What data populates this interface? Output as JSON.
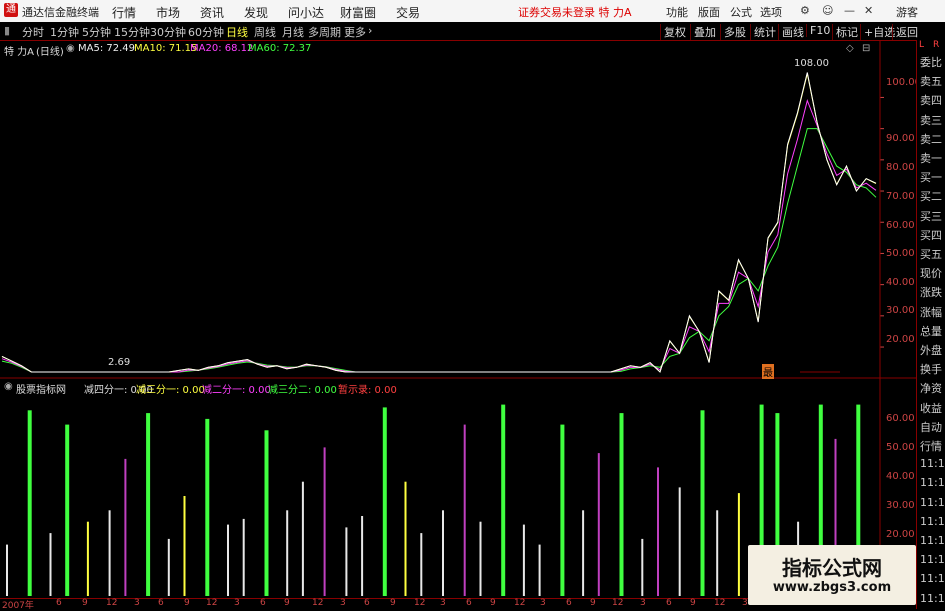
{
  "titlebar": {
    "logo": "通",
    "app_name": "通达信金融终端",
    "menus": [
      "行情",
      "市场",
      "资讯",
      "发现",
      "问小达",
      "财富圈",
      "交易"
    ],
    "notice": "证券交易未登录 特 力A",
    "right_menus": [
      "功能",
      "版面",
      "公式",
      "选项"
    ],
    "guest": "游客"
  },
  "toolbar": {
    "periods": [
      "分时",
      "1分钟",
      "5分钟",
      "15分钟",
      "30分钟",
      "60分钟",
      "日线",
      "周线",
      "月线",
      "多周期",
      "更多"
    ],
    "active": "日线",
    "right_buttons": [
      "复权",
      "叠加",
      "多股",
      "统计",
      "画线",
      "F10",
      "标记",
      "+自选",
      "返回"
    ]
  },
  "info": {
    "stock": "特 力A",
    "period": "(日线)",
    "ma5": "MA5: 72.49",
    "ma10": "MA10: 71.15",
    "ma20": "MA20: 68.12",
    "ma60": "MA60: 72.37"
  },
  "right_panel": {
    "corner_l": "L",
    "corner_r": "R",
    "items": [
      "委比",
      "卖五",
      "卖四",
      "卖三",
      "卖二",
      "卖一",
      "买一",
      "买二",
      "买三",
      "买四",
      "买五",
      "现价",
      "涨跌",
      "涨幅",
      "总量",
      "外盘",
      "换手",
      "净资",
      "收益",
      "自动",
      "行情",
      "11:1",
      "11:1",
      "11:1",
      "11:1",
      "11:1",
      "11:1",
      "11:1",
      "11:1"
    ]
  },
  "price_axis": [
    "100.00",
    "90.00",
    "80.00",
    "70.00",
    "60.00",
    "50.00",
    "40.00",
    "30.00",
    "20.00"
  ],
  "chart_annotations": {
    "high": "108.00",
    "low": "2.69",
    "marker": "最"
  },
  "indicator": {
    "name": "股票指标网",
    "f1": "减四分一: 0.00",
    "f2": "减三分一: 0.00",
    "f3": "减二分一: 0.00",
    "f4": "减三分二: 0.00",
    "f5": "暂示录: 0.00",
    "axis": [
      "60.00",
      "50.00",
      "40.00",
      "30.00",
      "20.00"
    ]
  },
  "date_axis": [
    "2007年",
    "6",
    "9",
    "12",
    "3",
    "6",
    "9",
    "12",
    "3",
    "6",
    "9",
    "12",
    "3",
    "6",
    "9",
    "12",
    "3",
    "6",
    "9",
    "12",
    "3",
    "6",
    "9",
    "12",
    "3",
    "6",
    "9",
    "12",
    "3",
    "6",
    "9",
    "12",
    "3",
    "6",
    "9",
    "12",
    "3",
    "6",
    "9",
    "12"
  ],
  "watermark": {
    "line1": "指标公式网",
    "line2": "www.zbgs3.com"
  },
  "chart_data": {
    "type": "line",
    "price_ylim": [
      12,
      112
    ],
    "close": [
      17,
      15.5,
      14,
      12,
      10,
      9,
      8,
      7.5,
      6.5,
      5.5,
      4.5,
      3.5,
      2.69,
      4,
      5.5,
      7,
      9.5,
      11,
      12.5,
      13,
      12.5,
      13.5,
      14,
      15,
      15.5,
      16,
      14.5,
      13.5,
      14,
      13,
      13.5,
      14.5,
      14,
      13.5,
      12.5,
      12,
      11,
      10,
      9.5,
      8.5,
      8,
      7.5,
      7,
      7,
      6.5,
      6,
      6.5,
      7,
      6.5,
      6,
      6,
      6.5,
      7,
      6,
      6.5,
      7,
      7.5,
      8,
      8.5,
      9,
      10,
      11,
      12,
      13,
      14,
      13.5,
      15,
      12,
      22,
      18,
      30,
      25,
      15,
      38,
      35,
      48,
      42,
      28,
      55,
      60,
      85,
      95,
      108,
      92,
      80,
      72,
      78,
      70,
      74,
      72.5
    ],
    "ma": [
      15.5,
      14.8,
      13.5,
      12,
      10.5,
      9.5,
      8.5,
      7.8,
      7,
      6,
      5,
      4.2,
      3.6,
      4.2,
      5.2,
      6.5,
      8.5,
      10,
      11.5,
      12.3,
      12.6,
      13,
      13.5,
      14.2,
      14.8,
      15.2,
      14.8,
      14.2,
      14,
      13.6,
      13.5,
      14,
      14,
      13.7,
      13.1,
      12.5,
      11.6,
      10.7,
      10,
      9.2,
      8.6,
      8,
      7.6,
      7.2,
      6.9,
      6.6,
      6.6,
      6.7,
      6.6,
      6.4,
      6.3,
      6.4,
      6.6,
      6.4,
      6.5,
      6.8,
      7.2,
      7.6,
      8.1,
      8.6,
      9.4,
      10.3,
      11.2,
      12.2,
      13,
      13.4,
      14,
      13.5,
      17,
      18,
      23,
      25,
      22,
      30,
      33,
      40,
      42,
      38,
      46,
      52,
      66,
      78,
      90,
      90,
      84,
      78,
      76,
      72,
      71,
      68
    ],
    "indicator_ylim": [
      0,
      70
    ],
    "bars": [
      {
        "series": "white",
        "value": 18
      },
      {
        "series": "green",
        "value": 65
      },
      {
        "series": "white",
        "value": 22
      },
      {
        "series": "green",
        "value": 60
      },
      {
        "series": "yellow",
        "value": 26
      },
      {
        "series": "white",
        "value": 30
      },
      {
        "series": "purple",
        "value": 48
      },
      {
        "series": "green",
        "value": 64
      },
      {
        "series": "white",
        "value": 20
      },
      {
        "series": "yellow",
        "value": 35
      },
      {
        "series": "green",
        "value": 62
      },
      {
        "series": "white",
        "value": 25
      },
      {
        "series": "white",
        "value": 27
      },
      {
        "series": "green",
        "value": 58
      },
      {
        "series": "white",
        "value": 30
      },
      {
        "series": "white",
        "value": 40
      },
      {
        "series": "purple",
        "value": 52
      },
      {
        "series": "white",
        "value": 24
      },
      {
        "series": "white",
        "value": 28
      },
      {
        "series": "green",
        "value": 66
      },
      {
        "series": "yellow",
        "value": 40
      },
      {
        "series": "white",
        "value": 22
      },
      {
        "series": "white",
        "value": 30
      },
      {
        "series": "purple",
        "value": 60
      },
      {
        "series": "white",
        "value": 26
      },
      {
        "series": "green",
        "value": 67
      },
      {
        "series": "white",
        "value": 25
      },
      {
        "series": "white",
        "value": 18
      },
      {
        "series": "green",
        "value": 60
      },
      {
        "series": "white",
        "value": 30
      },
      {
        "series": "purple",
        "value": 50
      },
      {
        "series": "green",
        "value": 64
      },
      {
        "series": "white",
        "value": 20
      },
      {
        "series": "purple",
        "value": 45
      },
      {
        "series": "white",
        "value": 38
      },
      {
        "series": "green",
        "value": 65
      },
      {
        "series": "white",
        "value": 30
      },
      {
        "series": "yellow",
        "value": 36
      },
      {
        "series": "green",
        "value": 67
      },
      {
        "series": "green",
        "value": 64
      },
      {
        "series": "white",
        "value": 26
      },
      {
        "series": "green",
        "value": 67
      },
      {
        "series": "purple",
        "value": 55
      },
      {
        "series": "green",
        "value": 67
      }
    ]
  }
}
